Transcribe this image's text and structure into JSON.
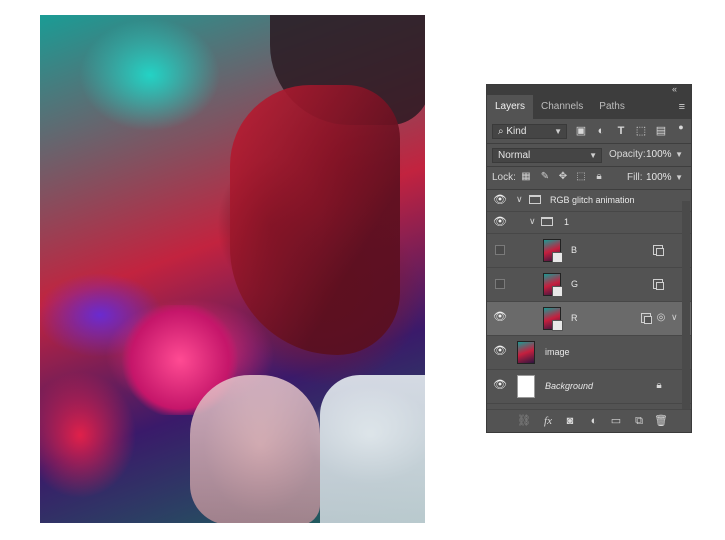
{
  "panel": {
    "collapse_icon": "«",
    "close_icon": "×",
    "tabs": [
      {
        "label": "Layers",
        "active": true
      },
      {
        "label": "Channels",
        "active": false
      },
      {
        "label": "Paths",
        "active": false
      }
    ],
    "menu_icon": "≡",
    "filter": {
      "kind_label": "Kind",
      "icons": [
        "image-filter-icon",
        "adjustment-filter-icon",
        "type-filter-icon",
        "shape-filter-icon",
        "smart-object-filter-icon",
        "filter-toggle-icon"
      ]
    },
    "blend_mode": "Normal",
    "opacity_label": "Opacity:",
    "opacity_value": "100%",
    "lock_label": "Lock:",
    "fill_label": "Fill:",
    "fill_value": "100%",
    "layers": [
      {
        "name": "RGB glitch animation",
        "type": "group",
        "visible": true
      },
      {
        "name": "1",
        "type": "group",
        "visible": true
      },
      {
        "name": "B",
        "type": "smart-object",
        "visible": false
      },
      {
        "name": "G",
        "type": "smart-object",
        "visible": false
      },
      {
        "name": "R",
        "type": "smart-object",
        "visible": true,
        "selected": true
      },
      {
        "name": "image",
        "type": "pixel",
        "visible": true
      },
      {
        "name": "Background",
        "type": "background",
        "visible": true,
        "locked": true
      }
    ],
    "bottom_icons": [
      "link-icon",
      "fx-icon",
      "mask-icon",
      "adjustment-icon",
      "folder-icon",
      "new-layer-icon",
      "trash-icon"
    ],
    "fx_label": "fx"
  },
  "colors": {
    "panel_bg": "#535353",
    "tab_bar": "#3d3d3d",
    "selected_layer": "#6a6a6a"
  }
}
